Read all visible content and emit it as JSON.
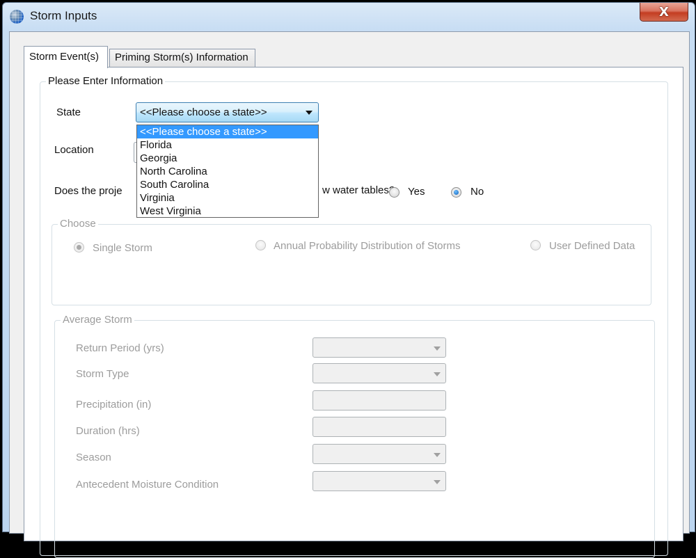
{
  "window": {
    "title": "Storm Inputs",
    "icon": "globe-icon",
    "close_glyph": "X"
  },
  "tabs": [
    {
      "label": "Storm Event(s)",
      "active": true
    },
    {
      "label": "Priming Storm(s) Information",
      "active": false
    }
  ],
  "info_group": {
    "legend": "Please Enter Information",
    "state": {
      "label": "State",
      "selected": "<<Please choose a state>>",
      "dropdown_open": true,
      "options": [
        "<<Please choose a state>>",
        "Florida",
        "Georgia",
        "North Carolina",
        "South Carolina",
        "Virginia",
        "West Virginia"
      ],
      "highlighted_index": 0
    },
    "location": {
      "label": "Location",
      "value": ""
    },
    "water_table": {
      "question_prefix": "Does the proje",
      "question_suffix": "w water tables?",
      "options": [
        {
          "label": "Yes",
          "checked": false
        },
        {
          "label": "No",
          "checked": true
        }
      ]
    }
  },
  "choose_group": {
    "legend": "Choose",
    "enabled": false,
    "options": [
      {
        "label": "Single Storm",
        "checked": true
      },
      {
        "label": "Annual Probability Distribution of Storms",
        "checked": false
      },
      {
        "label": "User Defined Data",
        "checked": false
      }
    ]
  },
  "average_storm": {
    "legend": "Average Storm",
    "enabled": false,
    "fields": [
      {
        "label": "Return Period (yrs)",
        "type": "combo",
        "value": ""
      },
      {
        "label": "Storm Type",
        "type": "combo",
        "value": ""
      },
      {
        "label": "Precipitation (in)",
        "type": "text",
        "value": ""
      },
      {
        "label": "Duration (hrs)",
        "type": "text",
        "value": ""
      },
      {
        "label": "Season",
        "type": "combo",
        "value": ""
      },
      {
        "label": "Antecedent Moisture Condition",
        "type": "combo",
        "value": ""
      }
    ]
  }
}
